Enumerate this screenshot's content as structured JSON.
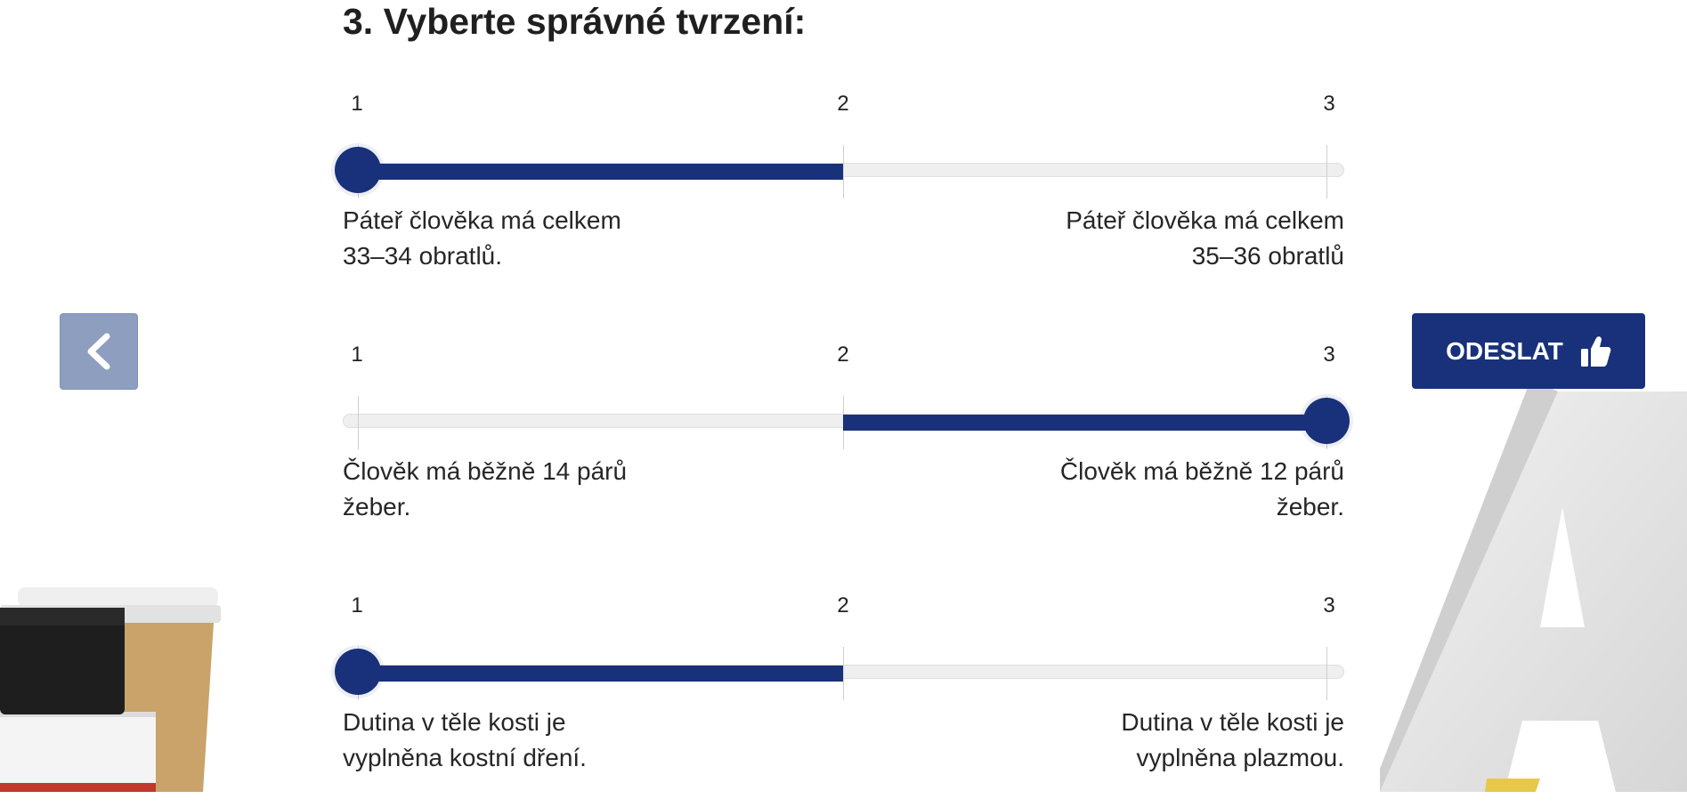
{
  "question": {
    "title": "3. Vyberte správné tvrzení:"
  },
  "sliders": [
    {
      "ticks": [
        "1",
        "2",
        "3"
      ],
      "value": 1,
      "left_label_line1": "Páteř člověka má celkem",
      "left_label_line2": "33–34 obratlů.",
      "right_label_line1": "Páteř člověka má celkem",
      "right_label_line2": "35–36 obratlů"
    },
    {
      "ticks": [
        "1",
        "2",
        "3"
      ],
      "value": 3,
      "left_label_line1": "Člověk má běžně 14 párů",
      "left_label_line2": "žeber.",
      "right_label_line1": "Člověk má běžně 12 párů",
      "right_label_line2": "žeber."
    },
    {
      "ticks": [
        "1",
        "2",
        "3"
      ],
      "value": 1,
      "left_label_line1": "Dutina v těle kosti je",
      "left_label_line2": "vyplněna kostní dření.",
      "right_label_line1": "Dutina v těle kosti je",
      "right_label_line2": "vyplněna plazmou."
    }
  ],
  "navigation": {
    "back_icon": "chevron-left-icon",
    "submit_label": "ODESLAT",
    "submit_icon": "thumbs-up-icon"
  },
  "colors": {
    "accent": "#18317a",
    "back_button": "#8d9ebf",
    "track": "#efefef"
  }
}
